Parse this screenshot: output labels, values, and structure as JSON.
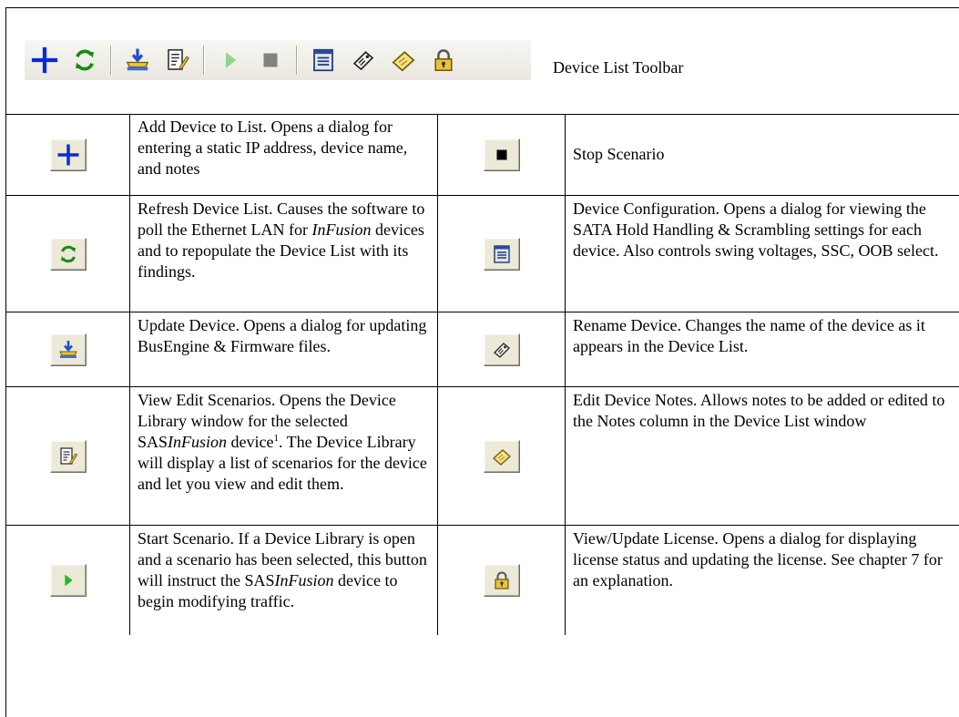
{
  "toolbar": {
    "caption": "Device List Toolbar",
    "icons": [
      "add-icon",
      "refresh-icon",
      "update-icon",
      "edit-scenario-icon",
      "start-icon",
      "stop-icon",
      "device-config-icon",
      "rename-icon",
      "notes-icon",
      "license-icon"
    ]
  },
  "rows": [
    {
      "left": {
        "icon": "add-icon",
        "text": "Add Device to List.  Opens a dialog for entering a static IP address, device name, and notes"
      },
      "right": {
        "icon": "stop-icon",
        "text": "Stop Scenario"
      }
    },
    {
      "left": {
        "icon": "refresh-icon",
        "text_a": "Refresh Device List.  Causes the software to poll the Ethernet LAN for ",
        "text_em": "InFusion",
        "text_b": " devices and to repopulate the Device List with its findings."
      },
      "right": {
        "icon": "device-config-icon",
        "text": "Device Configuration.  Opens a dialog for viewing the SATA Hold Handling & Scrambling  settings for each device. Also controls swing voltages, SSC, OOB select."
      }
    },
    {
      "left": {
        "icon": "update-icon",
        "text": "Update Device.  Opens a dialog for updating BusEngine & Firmware files."
      },
      "right": {
        "icon": "rename-icon",
        "text": "Rename Device.  Changes the name of the device as it appears in the Device List."
      }
    },
    {
      "left": {
        "icon": "edit-scenario-icon",
        "text_a": "View Edit Scenarios.  Opens the Device Library window for the selected SAS",
        "text_em": "InFusion",
        "text_b": " device",
        "sup": "1",
        "text_c": ". The Device Library will display a list of scenarios for the device and let you view and edit them."
      },
      "right": {
        "icon": "notes-icon",
        "text": "Edit Device Notes.  Allows notes to be added or edited to the Notes column in the Device List window"
      }
    },
    {
      "left": {
        "icon": "start-icon",
        "text_a": "Start Scenario.  If a Device Library is open and a scenario has been selected, this button will instruct the SAS",
        "text_em": "InFusion",
        "text_b": " device to begin modifying traffic."
      },
      "right": {
        "icon": "license-icon",
        "text": "View/Update License.  Opens a dialog for displaying license status and updating the license.  See chapter 7 for an explanation."
      }
    }
  ]
}
